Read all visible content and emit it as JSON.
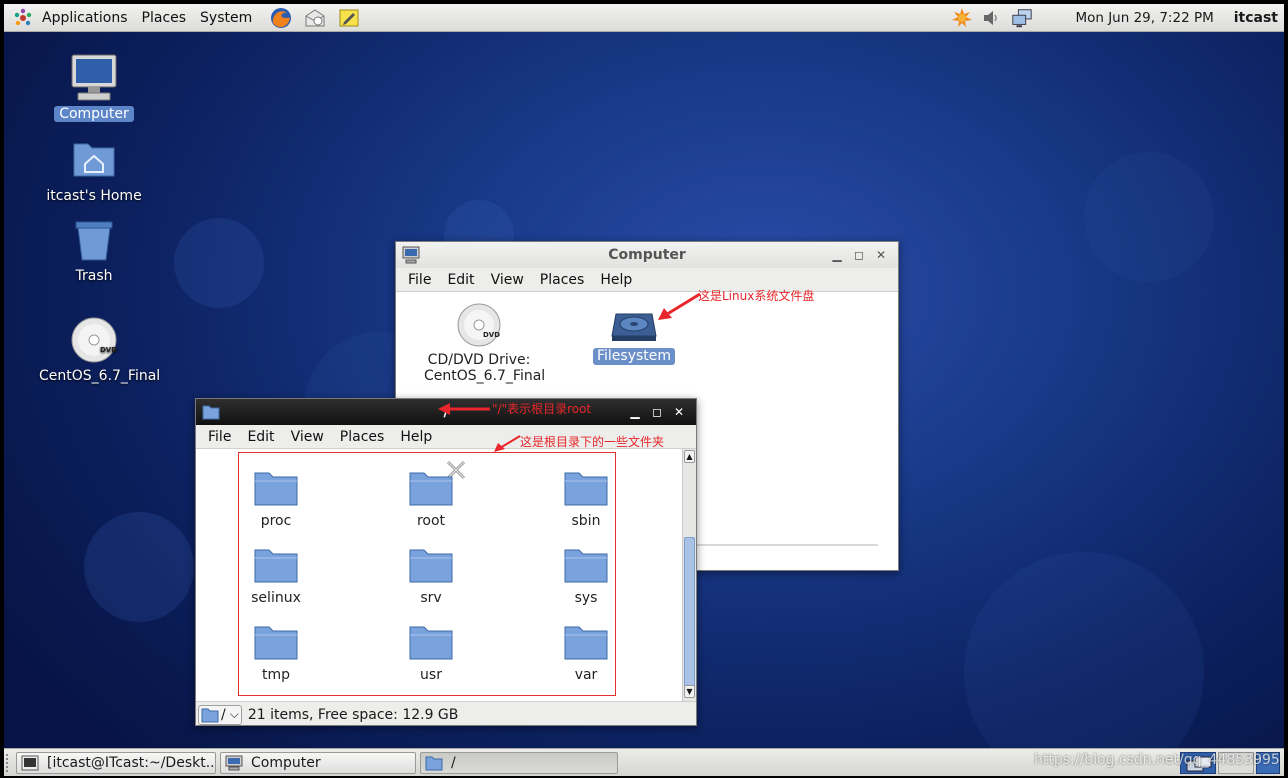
{
  "top_panel": {
    "menus": [
      "Applications",
      "Places",
      "System"
    ],
    "launchers": [
      "firefox-icon",
      "mail-icon",
      "notes-icon"
    ],
    "tray": [
      "update-icon",
      "volume-icon",
      "network-icon"
    ],
    "clock": "Mon Jun 29,  7:22 PM",
    "user": "itcast"
  },
  "desktop": {
    "icons": [
      {
        "label": "Computer",
        "icon": "computer-icon",
        "selected": true
      },
      {
        "label": "itcast's Home",
        "icon": "home-folder-icon"
      },
      {
        "label": "Trash",
        "icon": "trash-icon"
      },
      {
        "label": "CentOS_6.7_Final",
        "icon": "dvd-icon"
      }
    ]
  },
  "computer_window": {
    "title": "Computer",
    "menus": [
      "File",
      "Edit",
      "View",
      "Places",
      "Help"
    ],
    "items": [
      {
        "label_line1": "CD/DVD Drive:",
        "label_line2": "CentOS_6.7_Final",
        "icon": "dvd-icon"
      },
      {
        "label": "Filesystem",
        "icon": "harddisk-icon",
        "selected": true
      }
    ],
    "annotation": "这是Linux系统文件盘"
  },
  "root_window": {
    "title": "/",
    "title_annotation": "\"/\"表示根目录root",
    "menus": [
      "File",
      "Edit",
      "View",
      "Places",
      "Help"
    ],
    "folders_annotation": "这是根目录下的一些文件夹",
    "folders": [
      "proc",
      "root",
      "sbin",
      "selinux",
      "srv",
      "sys",
      "tmp",
      "usr",
      "var"
    ],
    "location": "/",
    "status": "21 items, Free space: 12.9 GB"
  },
  "taskbar": {
    "tasks": [
      "[itcast@ITcast:~/Deskt...",
      "Computer",
      "/"
    ],
    "watermark": "https://blog.csdn.net/qq_44853995"
  },
  "colors": {
    "selection": "#6b8fc9",
    "annotation_red": "#e8262b",
    "desktop_blue": "#183987"
  }
}
